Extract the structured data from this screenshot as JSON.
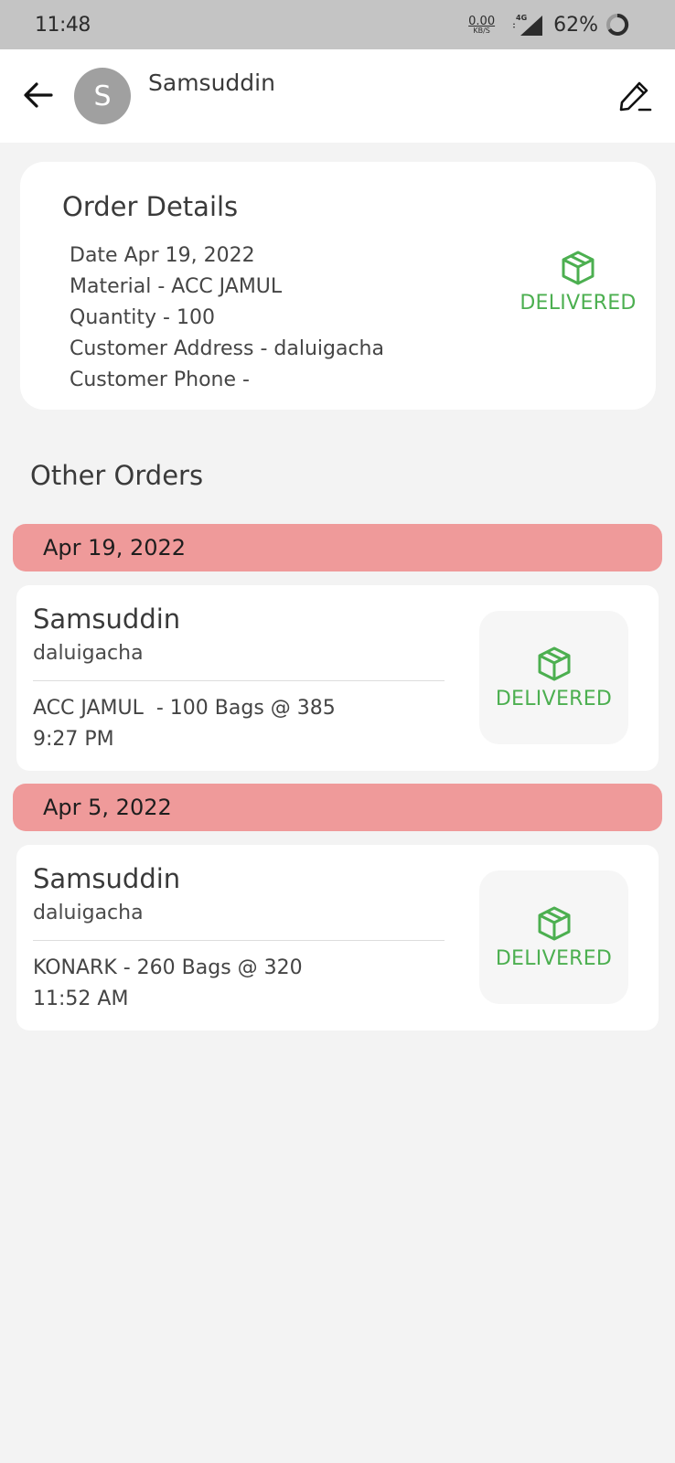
{
  "status_bar": {
    "time": "11:48",
    "net_speed": "0.00",
    "net_unit": "KB/S",
    "network_type": "4G",
    "battery": "62%"
  },
  "header": {
    "avatar_letter": "S",
    "name": "Samsuddin",
    "back_icon": "arrow-left-icon",
    "edit_icon": "pencil-icon"
  },
  "order_details": {
    "title": "Order Details",
    "date": "Date Apr 19, 2022",
    "material": "Material - ACC JAMUL",
    "quantity": "Quantity - 100",
    "address": "Customer Address - daluigacha",
    "phone": "Customer Phone -",
    "status": "DELIVERED"
  },
  "other_orders": {
    "title": "Other Orders",
    "groups": [
      {
        "date": "Apr 19, 2022",
        "order": {
          "name": "Samsuddin",
          "location": "daluigacha",
          "description": "ACC JAMUL  - 100 Bags @ 385",
          "time": "9:27 PM",
          "status": "DELIVERED"
        }
      },
      {
        "date": "Apr 5, 2022",
        "order": {
          "name": "Samsuddin",
          "location": "daluigacha",
          "description": "KONARK - 260 Bags @ 320",
          "time": "11:52 AM",
          "status": "DELIVERED"
        }
      }
    ]
  },
  "colors": {
    "status_green": "#4caf50",
    "date_band": "#ef9a9a",
    "avatar_bg": "#a0a0a0"
  }
}
